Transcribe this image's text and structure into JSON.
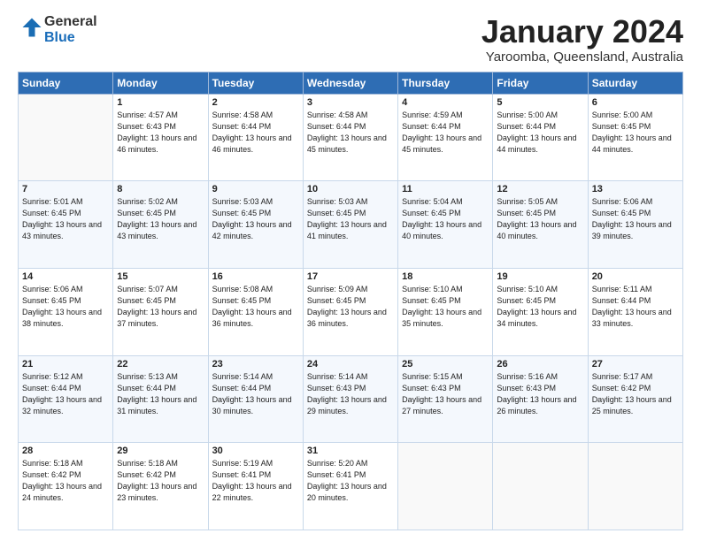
{
  "logo": {
    "general": "General",
    "blue": "Blue"
  },
  "header": {
    "month": "January 2024",
    "location": "Yaroomba, Queensland, Australia"
  },
  "days_of_week": [
    "Sunday",
    "Monday",
    "Tuesday",
    "Wednesday",
    "Thursday",
    "Friday",
    "Saturday"
  ],
  "weeks": [
    [
      {
        "day": "",
        "sunrise": "",
        "sunset": "",
        "daylight": ""
      },
      {
        "day": "1",
        "sunrise": "Sunrise: 4:57 AM",
        "sunset": "Sunset: 6:43 PM",
        "daylight": "Daylight: 13 hours and 46 minutes."
      },
      {
        "day": "2",
        "sunrise": "Sunrise: 4:58 AM",
        "sunset": "Sunset: 6:44 PM",
        "daylight": "Daylight: 13 hours and 46 minutes."
      },
      {
        "day": "3",
        "sunrise": "Sunrise: 4:58 AM",
        "sunset": "Sunset: 6:44 PM",
        "daylight": "Daylight: 13 hours and 45 minutes."
      },
      {
        "day": "4",
        "sunrise": "Sunrise: 4:59 AM",
        "sunset": "Sunset: 6:44 PM",
        "daylight": "Daylight: 13 hours and 45 minutes."
      },
      {
        "day": "5",
        "sunrise": "Sunrise: 5:00 AM",
        "sunset": "Sunset: 6:44 PM",
        "daylight": "Daylight: 13 hours and 44 minutes."
      },
      {
        "day": "6",
        "sunrise": "Sunrise: 5:00 AM",
        "sunset": "Sunset: 6:45 PM",
        "daylight": "Daylight: 13 hours and 44 minutes."
      }
    ],
    [
      {
        "day": "7",
        "sunrise": "Sunrise: 5:01 AM",
        "sunset": "Sunset: 6:45 PM",
        "daylight": "Daylight: 13 hours and 43 minutes."
      },
      {
        "day": "8",
        "sunrise": "Sunrise: 5:02 AM",
        "sunset": "Sunset: 6:45 PM",
        "daylight": "Daylight: 13 hours and 43 minutes."
      },
      {
        "day": "9",
        "sunrise": "Sunrise: 5:03 AM",
        "sunset": "Sunset: 6:45 PM",
        "daylight": "Daylight: 13 hours and 42 minutes."
      },
      {
        "day": "10",
        "sunrise": "Sunrise: 5:03 AM",
        "sunset": "Sunset: 6:45 PM",
        "daylight": "Daylight: 13 hours and 41 minutes."
      },
      {
        "day": "11",
        "sunrise": "Sunrise: 5:04 AM",
        "sunset": "Sunset: 6:45 PM",
        "daylight": "Daylight: 13 hours and 40 minutes."
      },
      {
        "day": "12",
        "sunrise": "Sunrise: 5:05 AM",
        "sunset": "Sunset: 6:45 PM",
        "daylight": "Daylight: 13 hours and 40 minutes."
      },
      {
        "day": "13",
        "sunrise": "Sunrise: 5:06 AM",
        "sunset": "Sunset: 6:45 PM",
        "daylight": "Daylight: 13 hours and 39 minutes."
      }
    ],
    [
      {
        "day": "14",
        "sunrise": "Sunrise: 5:06 AM",
        "sunset": "Sunset: 6:45 PM",
        "daylight": "Daylight: 13 hours and 38 minutes."
      },
      {
        "day": "15",
        "sunrise": "Sunrise: 5:07 AM",
        "sunset": "Sunset: 6:45 PM",
        "daylight": "Daylight: 13 hours and 37 minutes."
      },
      {
        "day": "16",
        "sunrise": "Sunrise: 5:08 AM",
        "sunset": "Sunset: 6:45 PM",
        "daylight": "Daylight: 13 hours and 36 minutes."
      },
      {
        "day": "17",
        "sunrise": "Sunrise: 5:09 AM",
        "sunset": "Sunset: 6:45 PM",
        "daylight": "Daylight: 13 hours and 36 minutes."
      },
      {
        "day": "18",
        "sunrise": "Sunrise: 5:10 AM",
        "sunset": "Sunset: 6:45 PM",
        "daylight": "Daylight: 13 hours and 35 minutes."
      },
      {
        "day": "19",
        "sunrise": "Sunrise: 5:10 AM",
        "sunset": "Sunset: 6:45 PM",
        "daylight": "Daylight: 13 hours and 34 minutes."
      },
      {
        "day": "20",
        "sunrise": "Sunrise: 5:11 AM",
        "sunset": "Sunset: 6:44 PM",
        "daylight": "Daylight: 13 hours and 33 minutes."
      }
    ],
    [
      {
        "day": "21",
        "sunrise": "Sunrise: 5:12 AM",
        "sunset": "Sunset: 6:44 PM",
        "daylight": "Daylight: 13 hours and 32 minutes."
      },
      {
        "day": "22",
        "sunrise": "Sunrise: 5:13 AM",
        "sunset": "Sunset: 6:44 PM",
        "daylight": "Daylight: 13 hours and 31 minutes."
      },
      {
        "day": "23",
        "sunrise": "Sunrise: 5:14 AM",
        "sunset": "Sunset: 6:44 PM",
        "daylight": "Daylight: 13 hours and 30 minutes."
      },
      {
        "day": "24",
        "sunrise": "Sunrise: 5:14 AM",
        "sunset": "Sunset: 6:43 PM",
        "daylight": "Daylight: 13 hours and 29 minutes."
      },
      {
        "day": "25",
        "sunrise": "Sunrise: 5:15 AM",
        "sunset": "Sunset: 6:43 PM",
        "daylight": "Daylight: 13 hours and 27 minutes."
      },
      {
        "day": "26",
        "sunrise": "Sunrise: 5:16 AM",
        "sunset": "Sunset: 6:43 PM",
        "daylight": "Daylight: 13 hours and 26 minutes."
      },
      {
        "day": "27",
        "sunrise": "Sunrise: 5:17 AM",
        "sunset": "Sunset: 6:42 PM",
        "daylight": "Daylight: 13 hours and 25 minutes."
      }
    ],
    [
      {
        "day": "28",
        "sunrise": "Sunrise: 5:18 AM",
        "sunset": "Sunset: 6:42 PM",
        "daylight": "Daylight: 13 hours and 24 minutes."
      },
      {
        "day": "29",
        "sunrise": "Sunrise: 5:18 AM",
        "sunset": "Sunset: 6:42 PM",
        "daylight": "Daylight: 13 hours and 23 minutes."
      },
      {
        "day": "30",
        "sunrise": "Sunrise: 5:19 AM",
        "sunset": "Sunset: 6:41 PM",
        "daylight": "Daylight: 13 hours and 22 minutes."
      },
      {
        "day": "31",
        "sunrise": "Sunrise: 5:20 AM",
        "sunset": "Sunset: 6:41 PM",
        "daylight": "Daylight: 13 hours and 20 minutes."
      },
      {
        "day": "",
        "sunrise": "",
        "sunset": "",
        "daylight": ""
      },
      {
        "day": "",
        "sunrise": "",
        "sunset": "",
        "daylight": ""
      },
      {
        "day": "",
        "sunrise": "",
        "sunset": "",
        "daylight": ""
      }
    ]
  ]
}
